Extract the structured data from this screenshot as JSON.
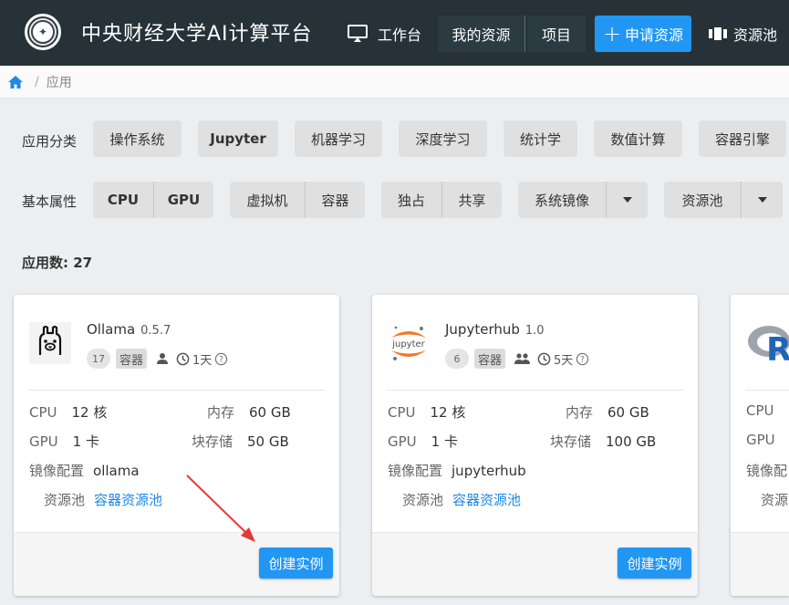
{
  "header": {
    "brand": "中央财经大学AI计算平台",
    "workspace": "工作台",
    "my_resources": "我的资源",
    "projects": "项目",
    "apply_resources": "申请资源",
    "resource_pool": "资源池",
    "colors": {
      "bar": "#263238",
      "accent": "#2196f3"
    }
  },
  "breadcrumb": {
    "current": "应用",
    "separator": "/"
  },
  "filters": {
    "category_label": "应用分类",
    "categories": [
      "操作系统",
      "Jupyter",
      "机器学习",
      "深度学习",
      "统计学",
      "数值计算",
      "容器引擎"
    ],
    "attr_label": "基本属性",
    "compute": [
      "CPU",
      "GPU"
    ],
    "virtualization": [
      "虚拟机",
      "容器"
    ],
    "sharing": [
      "独占",
      "共享"
    ],
    "system_image": "系统镜像",
    "resource_pool": "资源池"
  },
  "app_count": "应用数: 27",
  "cards": [
    {
      "name": "Ollama",
      "version": "0.5.7",
      "count": "17",
      "type_tag": "容器",
      "age": "1天",
      "cpu_label": "CPU",
      "cpu": "12 核",
      "mem_label": "内存",
      "mem": "60 GB",
      "gpu_label": "GPU",
      "gpu": "1 卡",
      "disk_label": "块存储",
      "disk": "50 GB",
      "image_label": "镜像配置",
      "image": "ollama",
      "pool_label": "资源池",
      "pool": "容器资源池",
      "create": "创建实例"
    },
    {
      "name": "Jupyterhub",
      "version": "1.0",
      "count": "6",
      "type_tag": "容器",
      "age": "5天",
      "cpu_label": "CPU",
      "cpu": "12 核",
      "mem_label": "内存",
      "mem": "60 GB",
      "gpu_label": "GPU",
      "gpu": "1 卡",
      "disk_label": "块存储",
      "disk": "100 GB",
      "image_label": "镜像配置",
      "image": "jupyterhub",
      "pool_label": "资源池",
      "pool": "容器资源池",
      "create": "创建实例",
      "logo_text": "jupyter"
    },
    {
      "logo_text": "R",
      "cpu_label": "CPU",
      "gpu_label": "GPU",
      "image_label": "镜像配",
      "pool_label": "资源"
    }
  ]
}
